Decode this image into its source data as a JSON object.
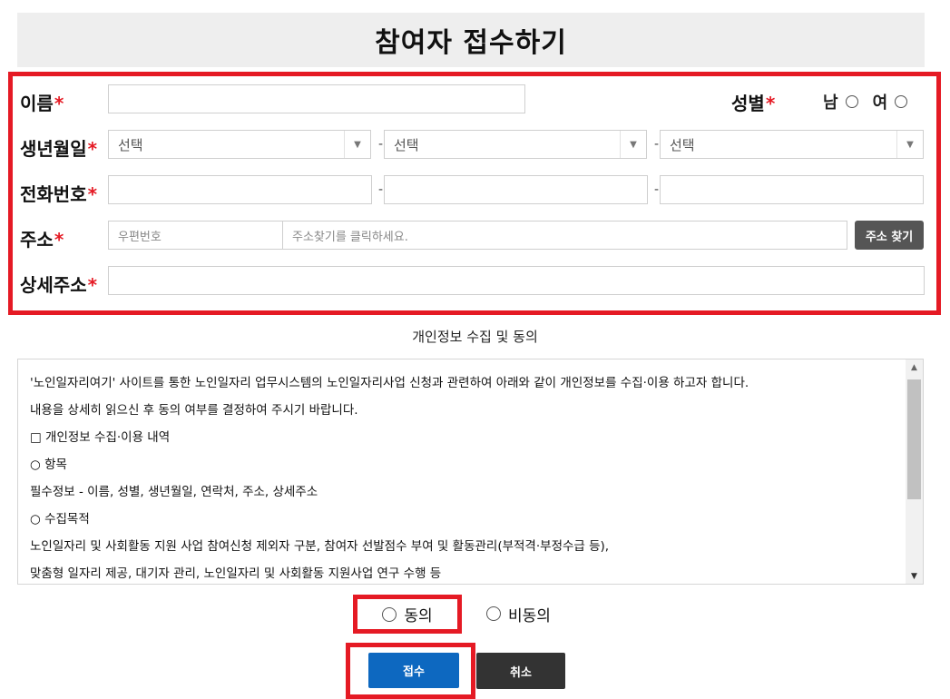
{
  "page": {
    "title": "참여자 접수하기"
  },
  "form": {
    "required_mark": "*",
    "name": {
      "label": "이름",
      "value": ""
    },
    "gender": {
      "label": "성별",
      "male": "남",
      "female": "여"
    },
    "birth": {
      "label": "생년월일",
      "year": "선택",
      "month": "선택",
      "day": "선택",
      "separator": "-"
    },
    "phone": {
      "label": "전화번호",
      "separator": "-"
    },
    "address": {
      "label": "주소",
      "zip_placeholder": "우편번호",
      "addr_placeholder": "주소찾기를 클릭하세요.",
      "search_button": "주소 찾기"
    },
    "detail_address": {
      "label": "상세주소",
      "value": ""
    }
  },
  "consent": {
    "title": "개인정보 수집 및 동의",
    "lines": [
      "'노인일자리여기' 사이트를 통한 노인일자리 업무시스템의 노인일자리사업 신청과 관련하여 아래와 같이 개인정보를 수집·이용 하고자 합니다.",
      "내용을 상세히 읽으신 후 동의 여부를 결정하여 주시기 바랍니다.",
      "□ 개인정보 수집·이용 내역",
      "○ 항목",
      "필수정보 - 이름, 성별, 생년월일, 연락처, 주소, 상세주소",
      "○ 수집목적",
      "노인일자리 및 사회활동 지원 사업 참여신청 제외자 구분, 참여자 선발점수 부여 및 활동관리(부적격·부정수급 등),",
      "맞춤형 일자리 제공, 대기자 관리, 노인일자리 및 사회활동 지원사업 연구 수행 등"
    ],
    "agree": "동의",
    "disagree": "비동의"
  },
  "actions": {
    "submit": "접수",
    "cancel": "취소"
  },
  "colors": {
    "highlight": "#e51a24",
    "primary": "#0d68c0",
    "dark": "#333333"
  }
}
